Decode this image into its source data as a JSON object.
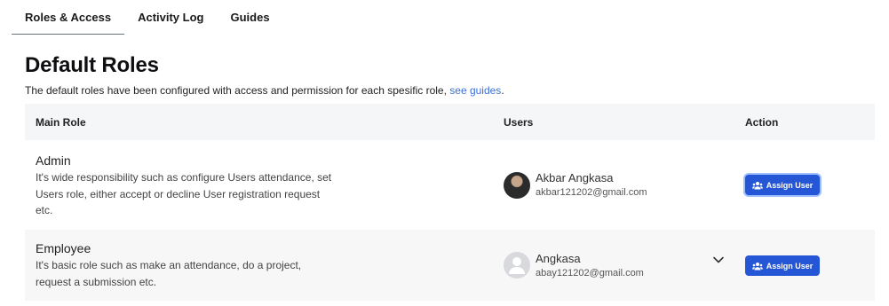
{
  "tabs": [
    {
      "label": "Roles & Access"
    },
    {
      "label": "Activity Log"
    },
    {
      "label": "Guides"
    }
  ],
  "page": {
    "title": "Default Roles",
    "subtitle": "The default roles have been configured with access and permission for each spesific role, ",
    "subtitle_link": "see guides",
    "subtitle_end": "."
  },
  "table": {
    "headers": {
      "role": "Main Role",
      "users": "Users",
      "action": "Action"
    },
    "rows": [
      {
        "role": "Admin",
        "description": "It's wide responsibility such as configure Users attendance, set Users role, either accept or decline User registration request etc.",
        "user_name": "Akbar Angkasa",
        "user_email": "akbar121202@gmail.com",
        "avatar": "user-photo",
        "action_label": "Assign User"
      },
      {
        "role": "Employee",
        "description": "It's basic role such as make an attendance, do a project, request a submission etc.",
        "user_name": "Angkasa",
        "user_email": "abay121202@gmail.com",
        "avatar": "default-avatar-icon",
        "action_label": "Assign User"
      }
    ]
  },
  "colors": {
    "accent": "#2456d6",
    "link": "#3b6fd6",
    "header_bg": "#f5f6f7"
  }
}
